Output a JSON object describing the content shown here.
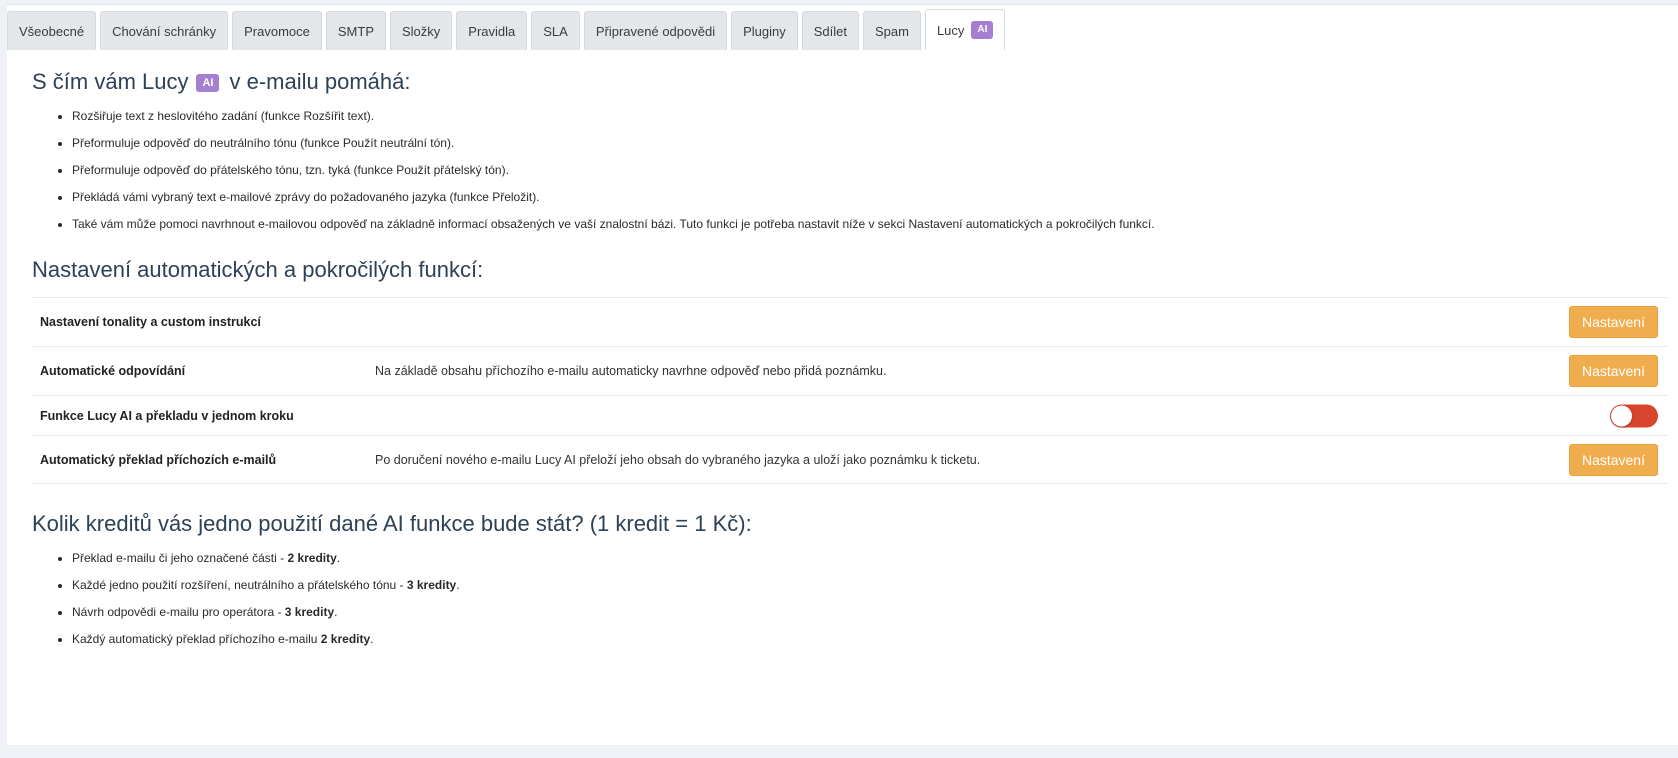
{
  "tabs": [
    {
      "label": "Všeobecné"
    },
    {
      "label": "Chování schránky"
    },
    {
      "label": "Pravomoce"
    },
    {
      "label": "SMTP"
    },
    {
      "label": "Složky"
    },
    {
      "label": "Pravidla"
    },
    {
      "label": "SLA"
    },
    {
      "label": "Připravené odpovědi"
    },
    {
      "label": "Pluginy"
    },
    {
      "label": "Sdílet"
    },
    {
      "label": "Spam"
    },
    {
      "label": "Lucy",
      "badge": "AI",
      "active": true
    }
  ],
  "help": {
    "heading_before": "S čím vám Lucy",
    "heading_badge": "AI",
    "heading_after": "v e-mailu pomáhá:",
    "items": [
      "Rozšiřuje text z heslovitého zadání (funkce Rozšířit text).",
      "Přeformuluje odpověď do neutrálního tónu (funkce Použít neutrální tón).",
      "Přeformuluje odpověď do přátelského tónu, tzn. tyká (funkce Použít přátelský tón).",
      "Překládá vámi vybraný text e-mailové zprávy do požadovaného jazyka (funkce Přeložit).",
      "Také vám může pomoci navrhnout e-mailovou odpověď na základně informací obsažených ve vaší znalostní bázi. Tuto funkci je potřeba nastavit níže v sekci Nastavení automatických a pokročilých funkcí."
    ]
  },
  "settings": {
    "heading": "Nastavení automatických a pokročilých funkcí:",
    "rows": [
      {
        "name": "Nastavení tonality a custom instrukcí",
        "desc": "",
        "button": "Nastavení"
      },
      {
        "name": "Automatické odpovídání",
        "desc": "Na základě obsahu příchozího e-mailu automaticky navrhne odpověď nebo přidá poznámku.",
        "button": "Nastavení"
      },
      {
        "name": "Funkce Lucy AI a překladu v jednom kroku",
        "desc": "",
        "toggle_on": false
      },
      {
        "name": "Automatický překlad příchozích e-mailů",
        "desc": "Po doručení nového e-mailu Lucy AI přeloží jeho obsah do vybraného jazyka a uloží jako poznámku k ticketu.",
        "button": "Nastavení"
      }
    ]
  },
  "credits": {
    "heading": "Kolik kreditů vás jedno použití dané AI funkce bude stát? (1 kredit = 1 Kč):",
    "items": [
      {
        "text": "Překlad e-mailu či jeho označené části - ",
        "bold": "2 kredity",
        "end": "."
      },
      {
        "text": "Každé jedno použití rozšíření, neutrálního a přátelského tónu - ",
        "bold": "3 kredity",
        "end": "."
      },
      {
        "text": "Návrh odpovědi e-mailu pro operátora - ",
        "bold": "3 kredity",
        "end": "."
      },
      {
        "text": "Každý automatický překlad příchozího e-mailu ",
        "bold": "2 kredity",
        "end": "."
      }
    ]
  },
  "colors": {
    "accent_button": "#f0ad4e",
    "ai_badge": "#a77fd1",
    "toggle_off": "#d9452b",
    "heading": "#2d4157"
  }
}
